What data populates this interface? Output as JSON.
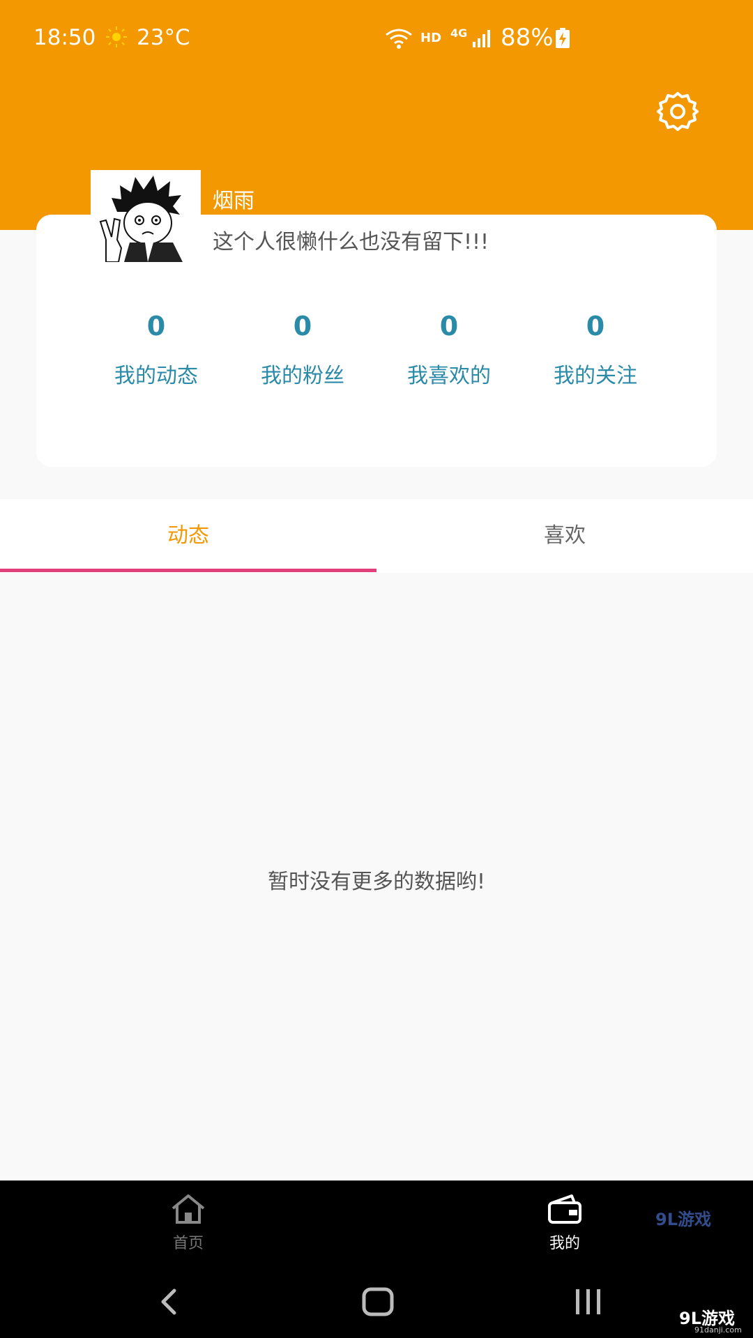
{
  "status_bar": {
    "time": "18:50",
    "weather_icon": "sun-icon",
    "temperature": "23°C",
    "network_hd": "HD",
    "network_type": "4G",
    "battery": "88%"
  },
  "colors": {
    "header": "#f39800",
    "accent_stat": "#2a8aa8",
    "tab_active": "#f39800",
    "tab_indicator": "#e2407a"
  },
  "profile": {
    "name": "烟雨",
    "bio": "这个人很懒什么也没有留下!!!"
  },
  "stats": [
    {
      "value": "0",
      "label": "我的动态"
    },
    {
      "value": "0",
      "label": "我的粉丝"
    },
    {
      "value": "0",
      "label": "我喜欢的"
    },
    {
      "value": "0",
      "label": "我的关注"
    }
  ],
  "tabs": [
    {
      "label": "动态",
      "active": true
    },
    {
      "label": "喜欢",
      "active": false
    }
  ],
  "empty_message": "暂时没有更多的数据哟!",
  "bottom_nav": [
    {
      "label": "首页",
      "icon": "home-icon",
      "active": false
    },
    {
      "label": "我的",
      "icon": "wallet-icon",
      "active": true
    }
  ],
  "watermark": {
    "brand": "9L游戏",
    "url": "91danji.com"
  }
}
